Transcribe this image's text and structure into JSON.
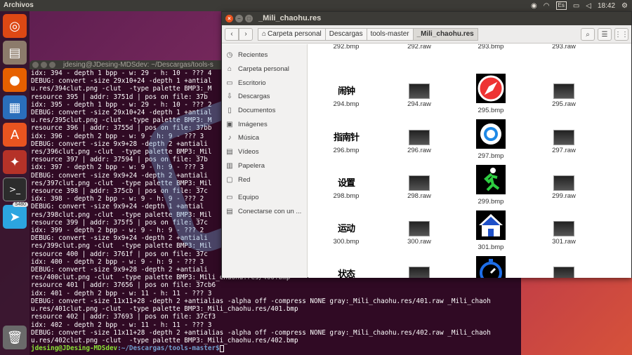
{
  "top_panel": {
    "app_name": "Archivos",
    "lang": "Es",
    "time": "18:42"
  },
  "launcher": {
    "telegram_badge": "5480"
  },
  "terminal": {
    "title": "jdesing@JDesing-MDSdev: ~/Descargas/tools-s",
    "lines": [
      "idx: 394 - depth 1 bpp - w: 29 - h: 10 - ??? 4",
      "DEBUG: convert -size 29x10+24 -depth 1 +antial",
      "u.res/394clut.png -clut  -type palette BMP3:_M",
      "resource 395 | addr: 3751d | pos on file: 37b",
      "idx: 395 - depth 1 bpp - w: 29 - h: 10 - ??? 2",
      "DEBUG: convert -size 29x10+24 -depth 1 +antial",
      "u.res/395clut.png -clut  -type palette BMP3:_M",
      "resource 396 | addr: 3755d | pos on file: 37bb",
      "idx: 396 - depth 2 bpp - w: 9 - h: 9 - ??? 3",
      "DEBUG: convert -size 9x9+28 -depth 2 +antiali",
      "res/396clut.png -clut  -type palette BMP3:_Mil",
      "resource 397 | addr: 37594 | pos on file: 37b",
      "idx: 397 - depth 2 bpp - w: 9 - h: 9 - ??? 3",
      "DEBUG: convert -size 9x9+24 -depth 2 +antiali",
      "res/397clut.png -clut  -type palette BMP3:_Mil",
      "resource 398 | addr: 375cb | pos on file: 37c",
      "idx: 398 - depth 2 bpp - w: 9 - h: 9 - ??? 2",
      "DEBUG: convert -size 9x9+24 -depth 1 +antial",
      "res/398clut.png -clut  -type palette BMP3:_Mil",
      "resource 399 | addr: 375f5 | pos on file: 37c",
      "idx: 399 - depth 2 bpp - w: 9 - h: 9 - ??? 2",
      "DEBUG: convert -size 9x9+24 -depth 2 +antiali",
      "res/399clut.png -clut  -type palette BMP3:_Mil",
      "resource 400 | addr: 3761f | pos on file: 37c",
      "idx: 400 - depth 2 bpp - w: 9 - h: 9 - ??? 3",
      "DEBUG: convert -size 9x9+28 -depth 2 +antiali",
      "res/400clut.png -clut  -type palette BMP3:_Mili_chaohu.res/400.bmp",
      "resource 401 | addr: 37656 | pos on file: 37cb6",
      "idx: 401 - depth 2 bpp - w: 11 - h: 11 - ??? 3",
      "DEBUG: convert -size 11x11+28 -depth 2 +antialias -alpha off -compress NONE gray:_Mili_chaohu.res/401.raw _Mili_chaoh",
      "u.res/401clut.png -clut  -type palette BMP3:_Mili_chaohu.res/401.bmp",
      "resource 402 | addr: 37693 | pos on file: 37cf3",
      "idx: 402 - depth 2 bpp - w: 11 - h: 11 - ??? 3",
      "DEBUG: convert -size 11x11+28 -depth 2 +antialias -alpha off -compress NONE gray:_Mili_chaohu.res/402.raw _Mili_chaoh",
      "u.res/402clut.png -clut  -type palette BMP3:_Mili_chaohu.res/402.bmp"
    ],
    "prompt_user": "jdesing@JDesing-MDSdev",
    "prompt_path": ":~/Descargas/tools-master$"
  },
  "filemanager": {
    "title": "_Mili_chaohu.res",
    "breadcrumbs": [
      "Carpeta personal",
      "Descargas",
      "tools-master",
      "_Mili_chaohu.res"
    ],
    "sidebar": [
      {
        "label": "Recientes",
        "icon": "clock-icon"
      },
      {
        "label": "Carpeta personal",
        "icon": "home-icon"
      },
      {
        "label": "Escritorio",
        "icon": "folder-icon"
      },
      {
        "label": "Descargas",
        "icon": "download-icon"
      },
      {
        "label": "Documentos",
        "icon": "document-icon"
      },
      {
        "label": "Imágenes",
        "icon": "image-icon"
      },
      {
        "label": "Música",
        "icon": "music-icon"
      },
      {
        "label": "Vídeos",
        "icon": "video-icon"
      },
      {
        "label": "Papelera",
        "icon": "trash-icon"
      },
      {
        "label": "Red",
        "icon": "network-icon"
      },
      {
        "label": "Equipo",
        "icon": "computer-icon"
      },
      {
        "label": "Conectarse con un ...",
        "icon": "server-icon"
      }
    ],
    "files": {
      "f292b": "292.bmp",
      "f292r": "292.raw",
      "f293b": "293.bmp",
      "f293r": "293.raw",
      "f294b": "294.bmp",
      "f294r": "294.raw",
      "f295b": "295.bmp",
      "f295r": "295.raw",
      "f296b": "296.bmp",
      "f296r": "296.raw",
      "f297b": "297.bmp",
      "f297r": "297.raw",
      "f298b": "298.bmp",
      "f298r": "298.raw",
      "f299b": "299.bmp",
      "f299r": "299.raw",
      "f300b": "300.bmp",
      "f300r": "300.raw",
      "f301b": "301.bmp",
      "f301r": "301.raw"
    },
    "thumb_text": {
      "t294": "闹钟",
      "t296": "指南针",
      "t298": "设置",
      "t300": "运动",
      "t302": "状态"
    }
  }
}
